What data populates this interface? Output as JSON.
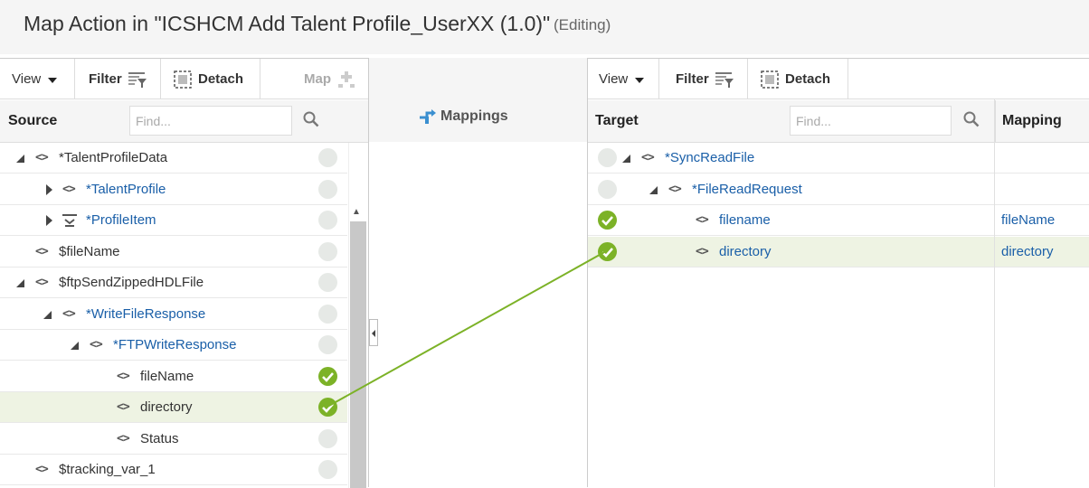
{
  "header": {
    "title": "Map Action in \"ICSHCM Add Talent Profile_UserXX (1.0)\"",
    "subtitle": "(Editing)"
  },
  "source": {
    "toolbar": {
      "view": "View",
      "filter": "Filter",
      "detach": "Detach",
      "map": "Map"
    },
    "header": "Source",
    "find_placeholder": "Find...",
    "rows": [
      {
        "label": "*TalentProfileData",
        "status": "unmapped"
      },
      {
        "label": "*TalentProfile",
        "status": "unmapped"
      },
      {
        "label": "*ProfileItem",
        "status": "unmapped"
      },
      {
        "label": "$fileName",
        "status": "unmapped"
      },
      {
        "label": "$ftpSendZippedHDLFile",
        "status": "unmapped"
      },
      {
        "label": "*WriteFileResponse",
        "status": "unmapped"
      },
      {
        "label": "*FTPWriteResponse",
        "status": "unmapped"
      },
      {
        "label": "fileName",
        "status": "mapped"
      },
      {
        "label": "directory",
        "status": "mapped"
      },
      {
        "label": "Status",
        "status": "unmapped"
      },
      {
        "label": "$tracking_var_1",
        "status": "unmapped"
      }
    ]
  },
  "middle": {
    "title": "Mappings"
  },
  "target": {
    "toolbar": {
      "view": "View",
      "filter": "Filter",
      "detach": "Detach"
    },
    "header": "Target",
    "find_placeholder": "Find...",
    "mapping_header": "Mapping",
    "rows": [
      {
        "label": "*SyncReadFile",
        "mapping": "",
        "status": "unmapped"
      },
      {
        "label": "*FileReadRequest",
        "mapping": "",
        "status": "unmapped"
      },
      {
        "label": "filename",
        "mapping": "fileName",
        "status": "mapped"
      },
      {
        "label": "directory",
        "mapping": "directory",
        "status": "mapped"
      }
    ]
  },
  "colors": {
    "accent_green": "#7cb227",
    "link_blue": "#1a5fa8",
    "selected_row": "#eef3e3"
  },
  "icons": [
    "caret-down-icon",
    "filter-icon",
    "detach-icon",
    "map-add-icon",
    "search-icon",
    "mappings-icon",
    "element-icon",
    "check-icon"
  ]
}
